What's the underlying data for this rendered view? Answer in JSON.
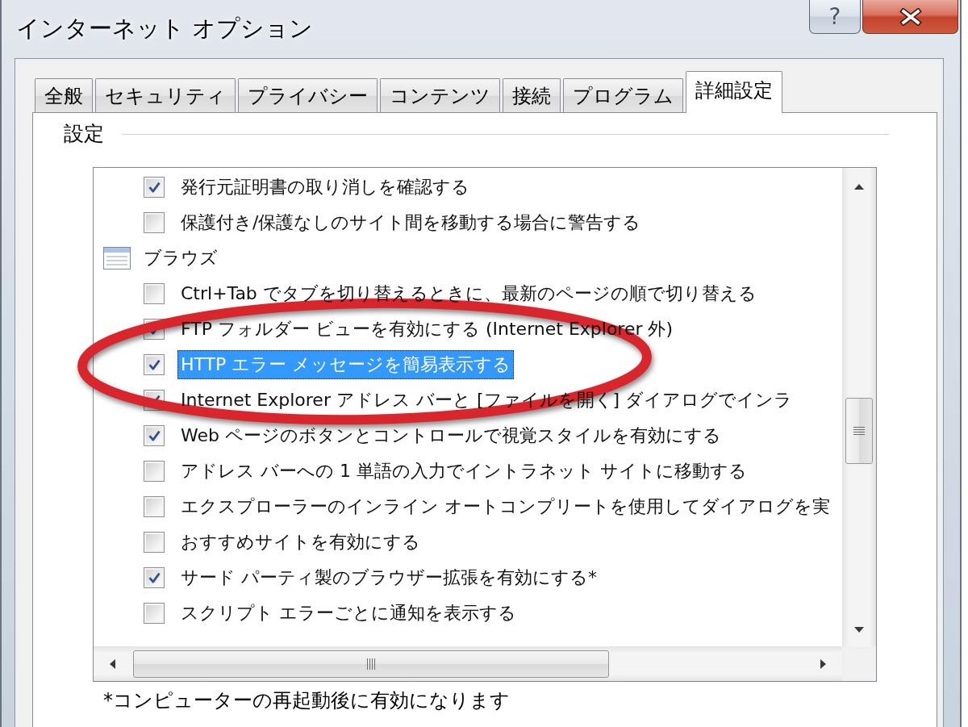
{
  "window": {
    "title": "インターネット オプション",
    "caption_buttons": [
      {
        "kind": "help",
        "label": "?"
      },
      {
        "kind": "close"
      }
    ]
  },
  "tabs": [
    {
      "label": "全般",
      "selected": false
    },
    {
      "label": "セキュリティ",
      "selected": false
    },
    {
      "label": "プライバシー",
      "selected": false
    },
    {
      "label": "コンテンツ",
      "selected": false
    },
    {
      "label": "接続",
      "selected": false
    },
    {
      "label": "プログラム",
      "selected": false
    },
    {
      "label": "詳細設定",
      "selected": true
    }
  ],
  "settings_group": {
    "label": "設定",
    "items": [
      {
        "kind": "continued",
        "children": [
          {
            "kind": "checkbox",
            "label": "発行元証明書の取り消しを確認する",
            "checked": true,
            "selected": false,
            "circled": false
          },
          {
            "kind": "checkbox",
            "label": "保護付き/保護なしのサイト間を移動する場合に警告する",
            "checked": false,
            "selected": false,
            "circled": false
          }
        ]
      },
      {
        "kind": "category",
        "label": "ブラウズ",
        "selected": false,
        "children": [
          {
            "kind": "checkbox",
            "label": "Ctrl+Tab でタブを切り替えるときに、最新のページの順で切り替える",
            "checked": false,
            "selected": false,
            "circled": false
          },
          {
            "kind": "checkbox",
            "label": "FTP フォルダー ビューを有効にする (Internet Explorer 外)",
            "checked": true,
            "selected": false,
            "circled": false
          },
          {
            "kind": "checkbox",
            "label": "HTTP エラー メッセージを簡易表示する",
            "checked": true,
            "selected": true,
            "circled": true
          },
          {
            "kind": "checkbox",
            "label": "Internet Explorer アドレス バーと [ファイルを開く] ダイアログでインラ",
            "checked": true,
            "selected": false,
            "circled": false
          },
          {
            "kind": "checkbox",
            "label": "Web ページのボタンとコントロールで視覚スタイルを有効にする",
            "checked": true,
            "selected": false,
            "circled": false
          },
          {
            "kind": "checkbox",
            "label": "アドレス バーへの 1 単語の入力でイントラネット サイトに移動する",
            "checked": false,
            "selected": false,
            "circled": false
          },
          {
            "kind": "checkbox",
            "label": "エクスプローラーのインライン オートコンプリートを使用してダイアログを実",
            "checked": false,
            "selected": false,
            "circled": false
          },
          {
            "kind": "checkbox",
            "label": "おすすめサイトを有効にする",
            "checked": false,
            "selected": false,
            "circled": false
          },
          {
            "kind": "checkbox",
            "label": "サード パーティ製のブラウザー拡張を有効にする*",
            "checked": true,
            "selected": false,
            "circled": false
          },
          {
            "kind": "checkbox",
            "label": "スクリプト エラーごとに通知を表示する",
            "checked": false,
            "selected": false,
            "circled": false
          }
        ]
      }
    ],
    "footnote": "*コンピューターの再起動後に有効になります"
  }
}
